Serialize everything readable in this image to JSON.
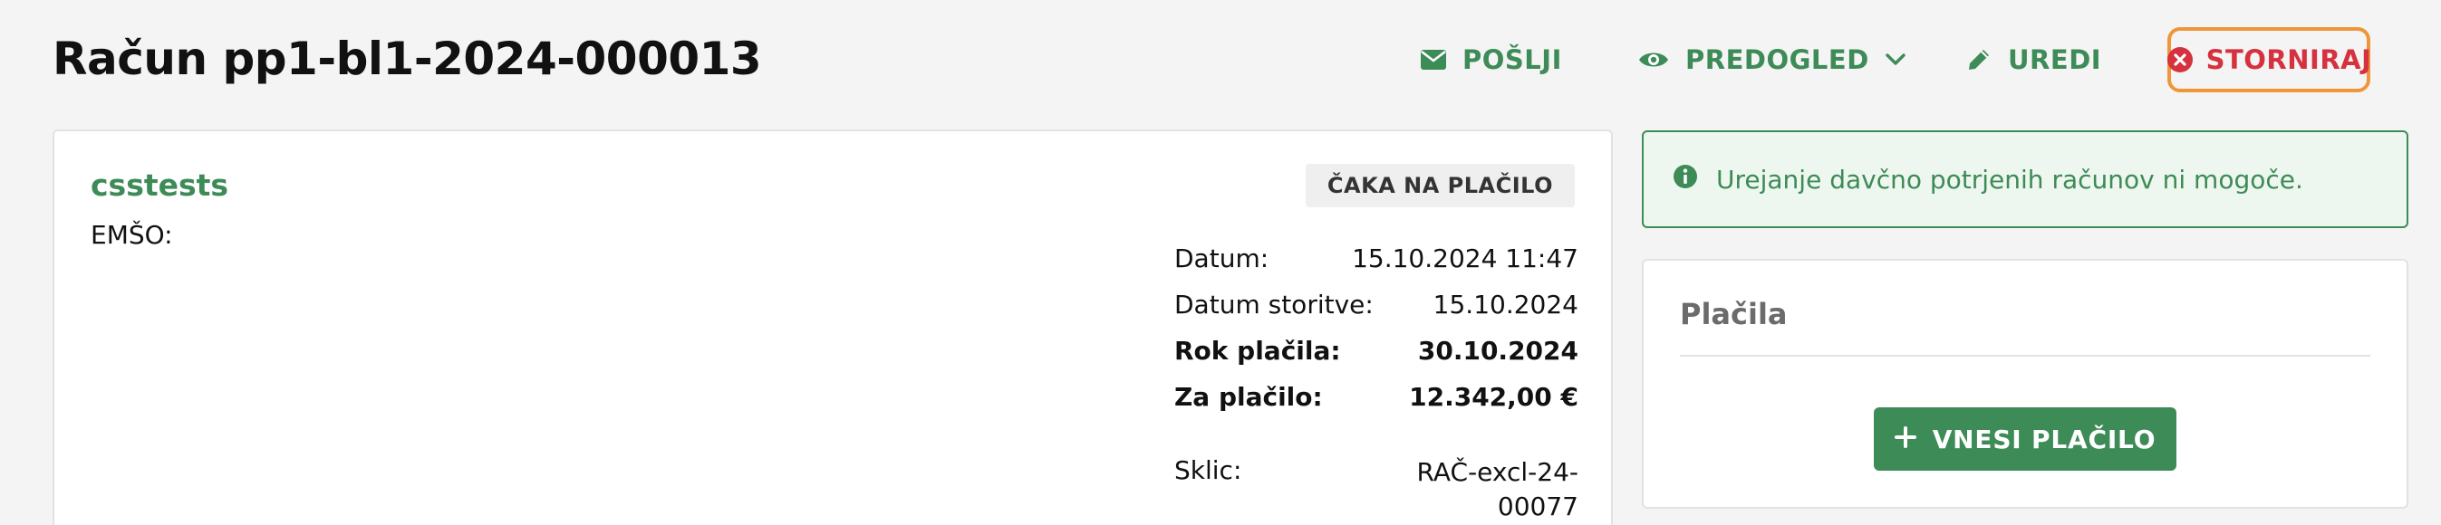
{
  "header": {
    "title": "Račun pp1-bl1-2024-000013",
    "actions": {
      "send": "POŠLJI",
      "preview": "PREDOGLED",
      "edit": "UREDI",
      "storno": "STORNIRAJ"
    }
  },
  "invoice": {
    "customer_name": "csstests",
    "emso_label": "EMŠO:",
    "status": "ČAKA NA PLAČILO",
    "meta": [
      {
        "label": "Datum:",
        "value": "15.10.2024 11:47"
      },
      {
        "label": "Datum storitve:",
        "value": "15.10.2024"
      },
      {
        "label": "Rok plačila:",
        "value": "30.10.2024"
      },
      {
        "label": "Za plačilo:",
        "value": "12.342,00 €"
      }
    ],
    "sklic": {
      "label": "Sklic:",
      "value_line1": "RAČ-excl-24-",
      "value_line2": "00077"
    }
  },
  "notice": {
    "text": "Urejanje davčno potrjenih računov ni mogoče."
  },
  "payments": {
    "title": "Plačila",
    "add_button": "VNESI PLAČILO"
  },
  "colors": {
    "accent_green": "#3d8b57",
    "danger_red": "#d6313e",
    "focus_orange": "#f0963a",
    "background": "#f4f4f4"
  },
  "icons": {
    "send": "envelope-icon",
    "preview": "eye-icon",
    "preview_dropdown": "chevron-down-icon",
    "edit": "pencil-icon",
    "storno": "x-circle-icon",
    "notice": "info-icon",
    "add_payment": "plus-icon"
  }
}
